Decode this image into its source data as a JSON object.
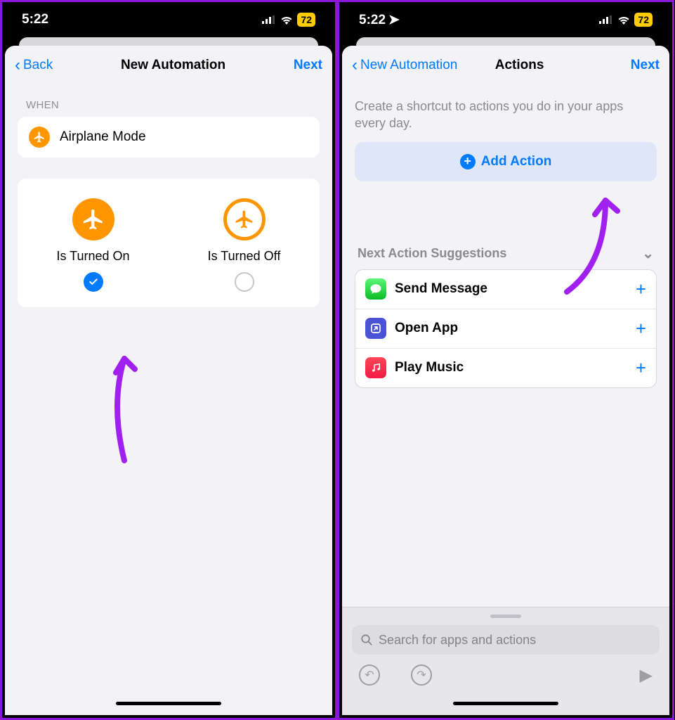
{
  "status": {
    "time": "5:22",
    "battery": "72"
  },
  "left": {
    "nav": {
      "back": "Back",
      "title": "New Automation",
      "next": "Next"
    },
    "section_when": "WHEN",
    "trigger": "Airplane Mode",
    "options": {
      "on": "Is Turned On",
      "off": "Is Turned Off"
    }
  },
  "right": {
    "nav": {
      "back": "New Automation",
      "title": "Actions",
      "next": "Next"
    },
    "description": "Create a shortcut to actions you do in your apps every day.",
    "add_action": "Add Action",
    "suggestions_header": "Next Action Suggestions",
    "suggestions": [
      {
        "label": "Send Message"
      },
      {
        "label": "Open App"
      },
      {
        "label": "Play Music"
      }
    ],
    "search_placeholder": "Search for apps and actions"
  }
}
